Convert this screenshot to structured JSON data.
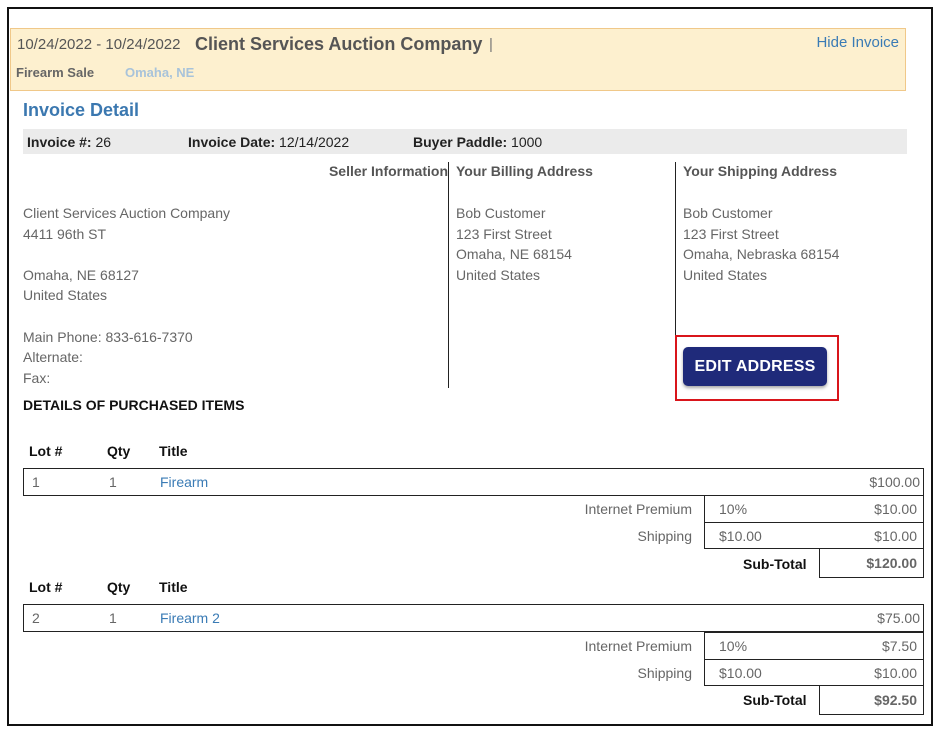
{
  "header": {
    "date_range": "10/24/2022 - 10/24/2022",
    "company": "Client Services Auction Company",
    "separator": "|",
    "hide_invoice": "Hide Invoice",
    "sale_type": "Firearm Sale",
    "location": "Omaha, NE"
  },
  "invoice": {
    "title": "Invoice Detail",
    "number_label": "Invoice #:",
    "number": "26",
    "date_label": "Invoice Date:",
    "date": "12/14/2022",
    "paddle_label": "Buyer Paddle:",
    "paddle": "1000"
  },
  "seller": {
    "heading": "Seller Information",
    "name": "Client Services Auction Company",
    "street": "4411 96th ST",
    "city": "Omaha, NE  68127",
    "country": "United States",
    "main_phone": "Main Phone: 833-616-7370",
    "alternate": "Alternate:",
    "fax": "Fax:"
  },
  "billing": {
    "heading": "Your Billing Address",
    "name": "Bob Customer",
    "street": "123 First Street",
    "city": "Omaha, NE  68154",
    "country": "United States"
  },
  "shipping": {
    "heading": "Your Shipping Address",
    "name": "Bob Customer",
    "street": "123 First Street",
    "city": "Omaha, Nebraska  68154",
    "country": "United States",
    "edit_button": "EDIT ADDRESS"
  },
  "details": {
    "title": "DETAILS OF PURCHASED ITEMS",
    "col_lot": "Lot #",
    "col_qty": "Qty",
    "col_title": "Title",
    "items": [
      {
        "lot": "1",
        "qty": "1",
        "title": "Firearm",
        "amount": "$100.00",
        "premium_label": "Internet Premium",
        "premium_rate": "10%",
        "premium_amount": "$10.00",
        "shipping_label": "Shipping",
        "shipping_rate": "$10.00",
        "shipping_amount": "$10.00",
        "subtotal_label": "Sub-Total",
        "subtotal": "$120.00"
      },
      {
        "lot": "2",
        "qty": "1",
        "title": "Firearm 2",
        "amount": "$75.00",
        "premium_label": "Internet Premium",
        "premium_rate": "10%",
        "premium_amount": "$7.50",
        "shipping_label": "Shipping",
        "shipping_rate": "$10.00",
        "shipping_amount": "$10.00",
        "subtotal_label": "Sub-Total",
        "subtotal": "$92.50"
      }
    ]
  }
}
